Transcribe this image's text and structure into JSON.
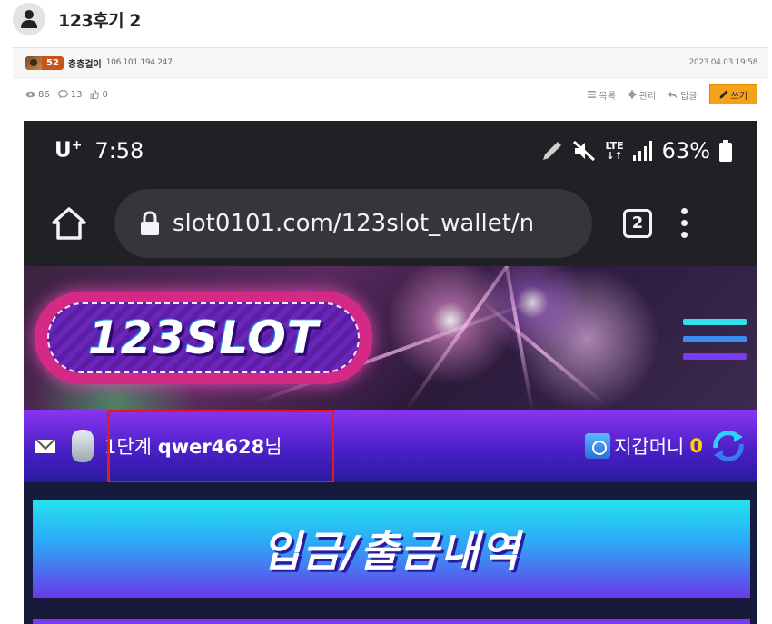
{
  "post": {
    "title": "123후기 2",
    "level": "52",
    "nickname": "충충걸이",
    "ip": "106.101.194.247",
    "date": "2023.04.03 19:58",
    "views": "86",
    "comments": "13",
    "likes": "0"
  },
  "actions": {
    "list_label": "목록",
    "manage_label": "관리",
    "reply_label": "답글",
    "write_label": "쓰기"
  },
  "phone": {
    "carrier": "U",
    "carrier_sup": "+",
    "time": "7:58",
    "lte_top": "LTE",
    "lte_bottom": "↓↑",
    "battery": "63%",
    "url": "slot0101.com/123slot_wallet/n",
    "tab_count": "2"
  },
  "site": {
    "logo_text": "123SLOT",
    "level_text": "1단계",
    "username": "qwer4628",
    "honorific": "님",
    "wallet_label": "지갑머니",
    "wallet_amount": "0",
    "history_button": "입금/출금내역"
  },
  "colors": {
    "write_button": "#f7a11a",
    "highlight_box": "#e01c1c",
    "user_bar": "#4a20c8",
    "wallet_amount": "#ffd400"
  }
}
